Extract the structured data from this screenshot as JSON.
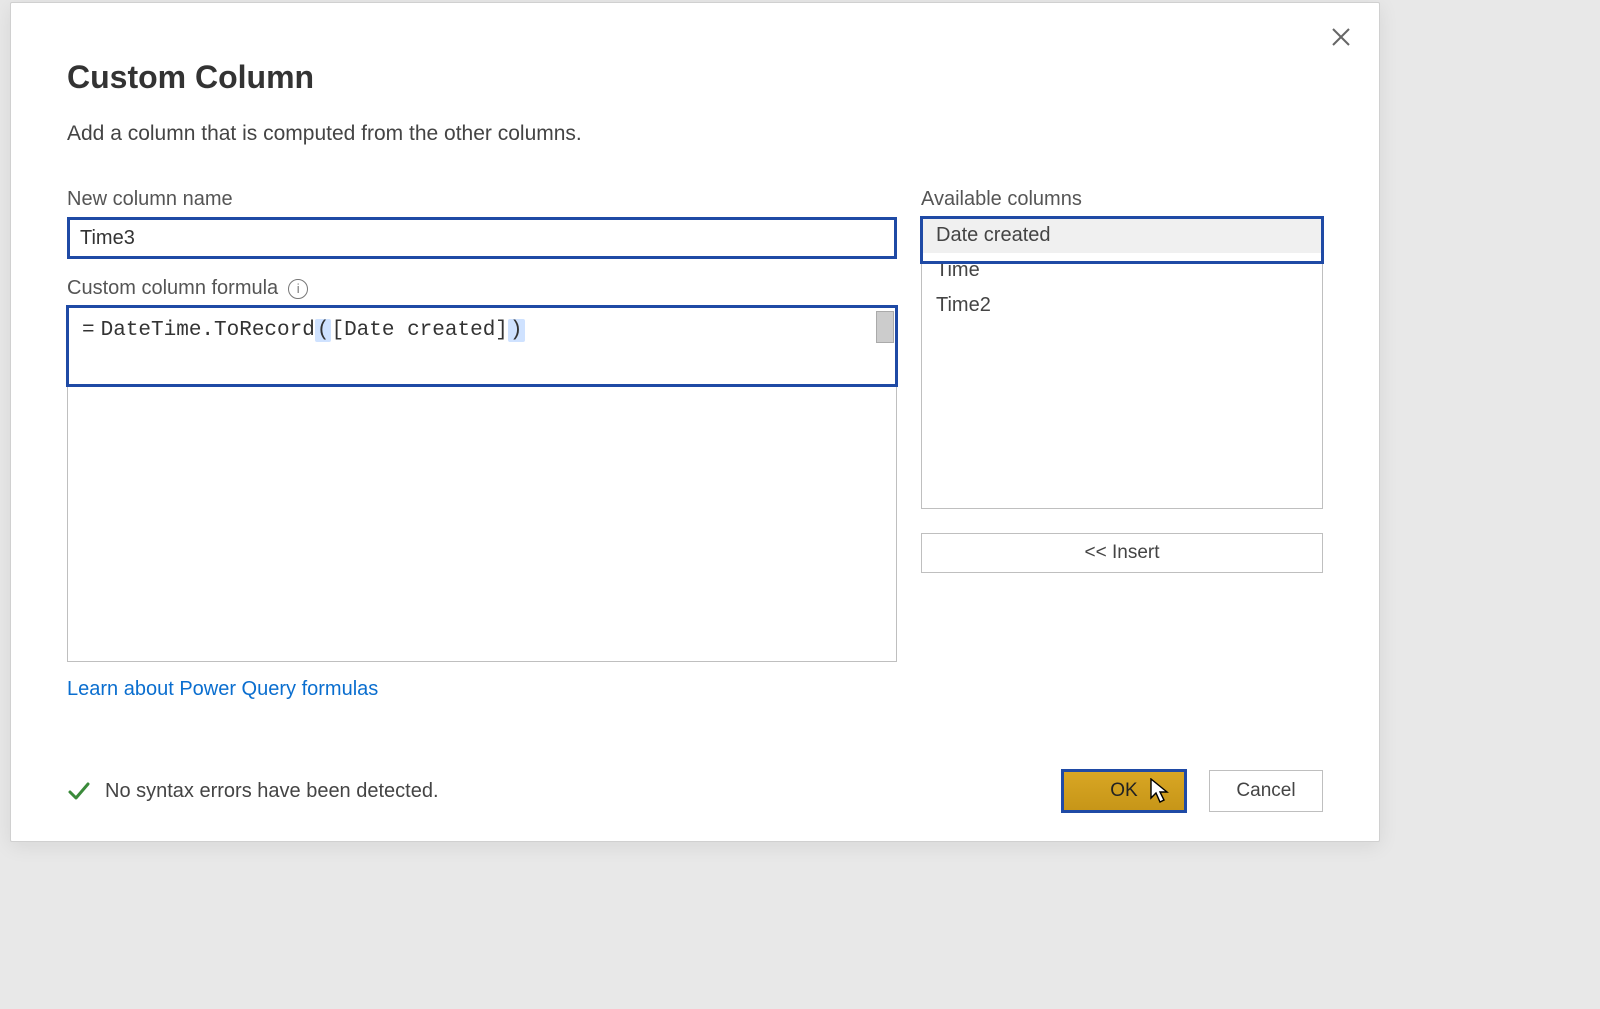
{
  "dialog": {
    "title": "Custom Column",
    "subtitle": "Add a column that is computed from the other columns.",
    "close_tooltip": "Close",
    "name_label": "New column name",
    "name_value": "Time3",
    "formula_label": "Custom column formula",
    "formula_prefix": "=",
    "formula_value": "DateTime.ToRecord([Date created])",
    "formula_fn": "DateTime.ToRecord",
    "formula_arg": "[Date created]",
    "available_label": "Available columns",
    "available_columns": [
      {
        "label": "Date created",
        "selected": true
      },
      {
        "label": "Time",
        "selected": false
      },
      {
        "label": "Time2",
        "selected": false
      }
    ],
    "insert_label": "<< Insert",
    "help_link": "Learn about Power Query formulas",
    "status_text": "No syntax errors have been detected.",
    "ok_label": "OK",
    "cancel_label": "Cancel"
  }
}
